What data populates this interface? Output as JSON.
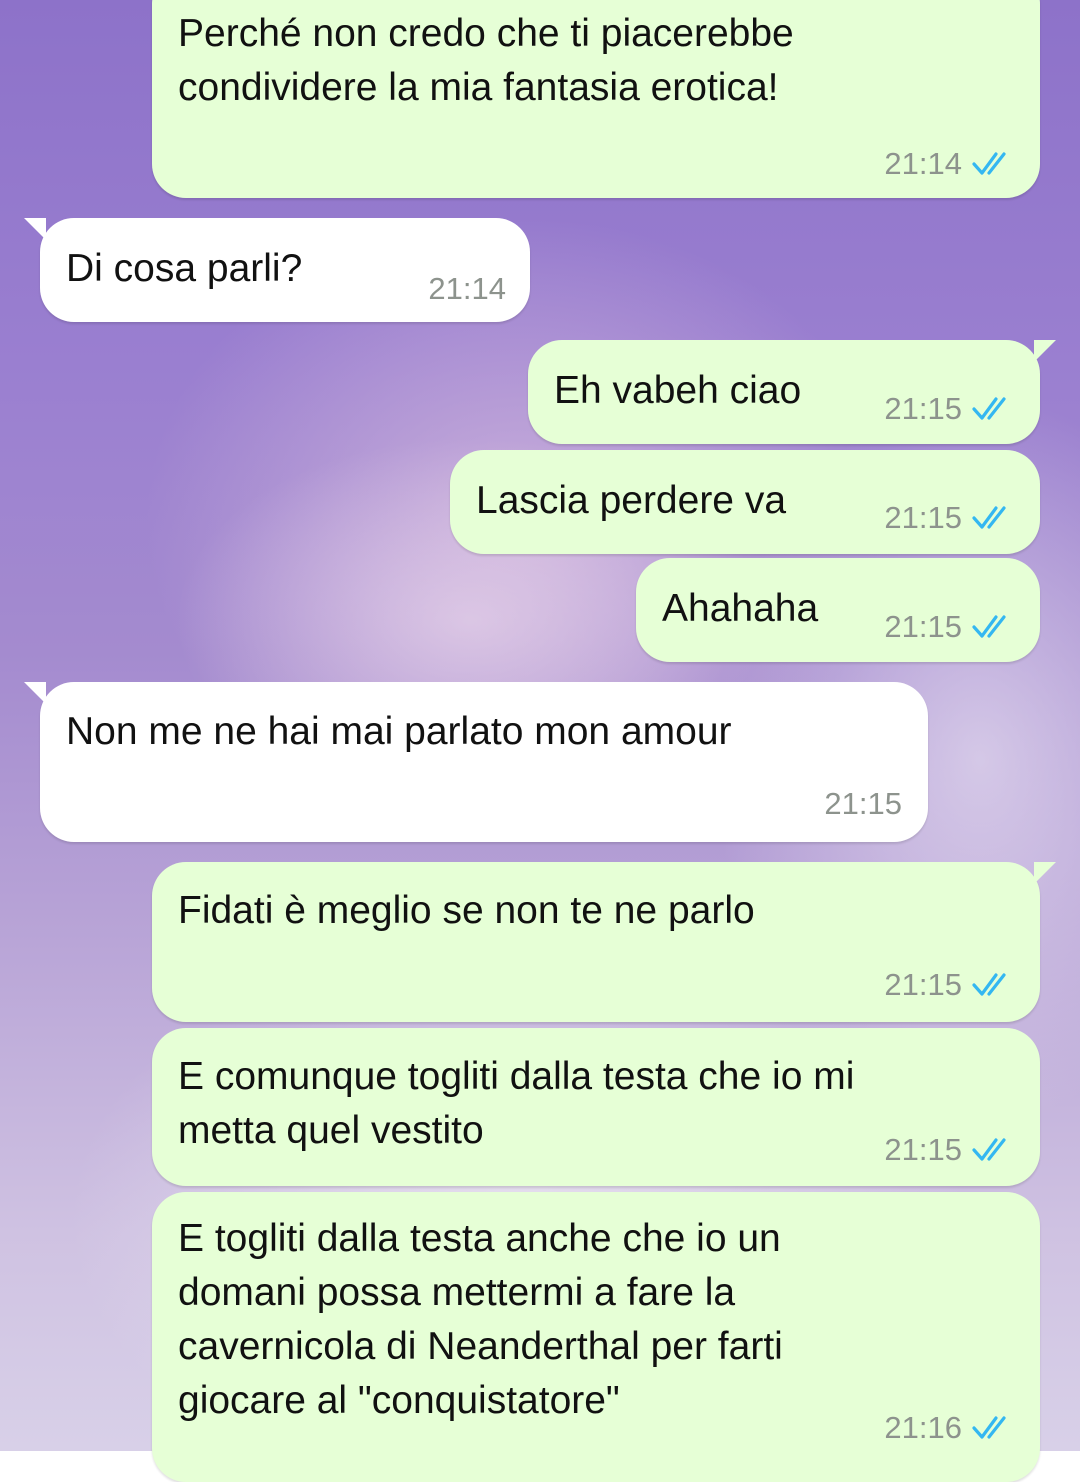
{
  "colors": {
    "outgoing_bubble": "#e6ffd6",
    "incoming_bubble": "#ffffff",
    "timestamp": "#8d938d",
    "read_checks": "#34b7f1",
    "message_text": "#111111"
  },
  "icons": {
    "read_receipt": "double-check-icon"
  },
  "messages": [
    {
      "direction": "outgoing",
      "text": "Perché non credo che ti piacerebbe\ncondividere la mia fantasia erotica!",
      "time": "21:14",
      "status": "read"
    },
    {
      "direction": "incoming",
      "text": "Di cosa parli?",
      "time": "21:14"
    },
    {
      "direction": "outgoing",
      "text": "Eh vabeh ciao",
      "time": "21:15",
      "status": "read"
    },
    {
      "direction": "outgoing",
      "text": "Lascia perdere va",
      "time": "21:15",
      "status": "read"
    },
    {
      "direction": "outgoing",
      "text": "Ahahaha",
      "time": "21:15",
      "status": "read"
    },
    {
      "direction": "incoming",
      "text": "Non me ne hai mai parlato mon amour",
      "time": "21:15"
    },
    {
      "direction": "outgoing",
      "text": "Fidati è meglio se non te ne parlo",
      "time": "21:15",
      "status": "read"
    },
    {
      "direction": "outgoing",
      "text": "E comunque togliti dalla testa che io mi\nmetta quel vestito",
      "time": "21:15",
      "status": "read"
    },
    {
      "direction": "outgoing",
      "text": "E togliti dalla testa anche che io un\ndomani possa mettermi a fare la\ncavernicola di Neanderthal per farti\ngiocare al \"conquistatore\"",
      "time": "21:16",
      "status": "read"
    }
  ]
}
